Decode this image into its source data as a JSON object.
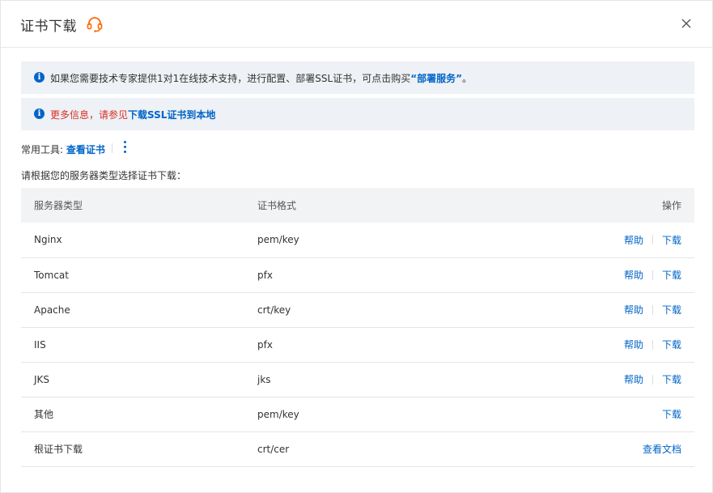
{
  "dialog": {
    "title": "证书下载",
    "icons": {
      "headset": "headset-icon",
      "close": "close-icon",
      "info": "info-icon",
      "more": "kebab-menu-icon"
    }
  },
  "alert1": {
    "text": "如果您需要技术专家提供1对1在线技术支持，进行配置、部署SSL证书，可点击购买",
    "link": "“部署服务”",
    "suffix": "。"
  },
  "alert2": {
    "text": "更多信息，请参见",
    "link": "下载SSL证书到本地"
  },
  "tools": {
    "label": "常用工具:",
    "link": "查看证书"
  },
  "hint": "请根据您的服务器类型选择证书下载：",
  "table": {
    "headers": [
      "服务器类型",
      "证书格式",
      "操作"
    ],
    "rows": [
      {
        "server": "Nginx",
        "format": "pem/key",
        "help": "帮助",
        "action": "下载"
      },
      {
        "server": "Tomcat",
        "format": "pfx",
        "help": "帮助",
        "action": "下载"
      },
      {
        "server": "Apache",
        "format": "crt/key",
        "help": "帮助",
        "action": "下载"
      },
      {
        "server": "IIS",
        "format": "pfx",
        "help": "帮助",
        "action": "下载"
      },
      {
        "server": "JKS",
        "format": "jks",
        "help": "帮助",
        "action": "下载"
      },
      {
        "server": "其他",
        "format": "pem/key",
        "help": "",
        "action": "下载"
      },
      {
        "server": "根证书下载",
        "format": "crt/cer",
        "help": "",
        "action": "查看文档"
      }
    ]
  },
  "colors": {
    "link": "#0064c8",
    "alert_bg": "#eef1f5",
    "warning_text": "#d93026",
    "brand_orange": "#ff6a00"
  }
}
